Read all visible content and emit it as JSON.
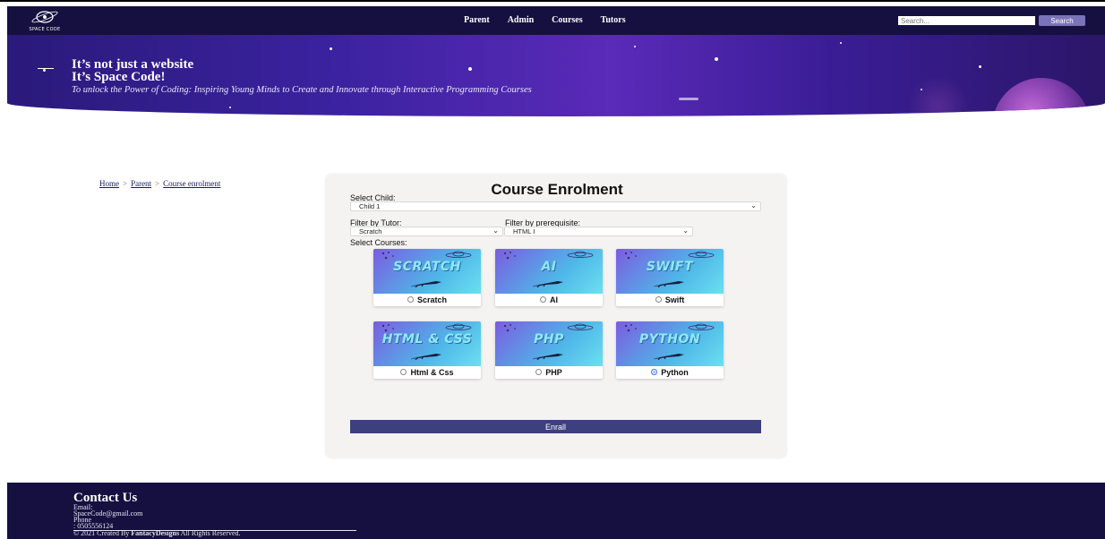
{
  "navbar": {
    "logo_text": "SPACE CODE",
    "links": [
      "Parent",
      "Admin",
      "Courses",
      "Tutors"
    ],
    "search_placeholder": "Search...",
    "search_button": "Search"
  },
  "hero": {
    "title_line1": "It’s not just a website",
    "title_line2": "It’s Space Code!",
    "subtitle": "To unlock the Power of Coding: Inspiring Young Minds to Create and Innovate through Interactive Programming Courses"
  },
  "breadcrumb": [
    "Home",
    "Parent",
    "Course enrolment"
  ],
  "form": {
    "title": "Course Enrolment",
    "select_child_label": "Select Child:",
    "select_child_value": "Child 1",
    "filter_tutor_label": "Filter by Tutor:",
    "filter_tutor_value": "Scratch",
    "filter_prereq_label": "Filter by prerequisite:",
    "filter_prereq_value": "HTML I",
    "select_courses_label": "Select Courses:",
    "courses": [
      {
        "label": "Scratch",
        "image_text": "SCRATCH",
        "selected": false
      },
      {
        "label": "AI",
        "image_text": "AI",
        "selected": false
      },
      {
        "label": "Swift",
        "image_text": "SWIFT",
        "selected": false
      },
      {
        "label": "Html & Css",
        "image_text": "HTML & CSS",
        "selected": false
      },
      {
        "label": "PHP",
        "image_text": "PHP",
        "selected": false
      },
      {
        "label": "Python",
        "image_text": "PYTHON",
        "selected": true
      }
    ],
    "enroll_button": "Enrall"
  },
  "footer": {
    "title": "Contact Us",
    "email_label": "Email:",
    "email": "SpaceCode@gmail.com",
    "phone_label": "Phone",
    "phone": ": 0505556124",
    "copyright_prefix": "© 2021 Created By ",
    "copyright_brand": "FantacyDesigns",
    "copyright_suffix": " All Rights Reserved."
  },
  "colors": {
    "navbar_bg": "#161040",
    "footer_bg": "#161040",
    "button_bg": "#3d3f7e",
    "search_button_bg": "#7b73b8",
    "hero_accent": "#5a2ab8"
  }
}
